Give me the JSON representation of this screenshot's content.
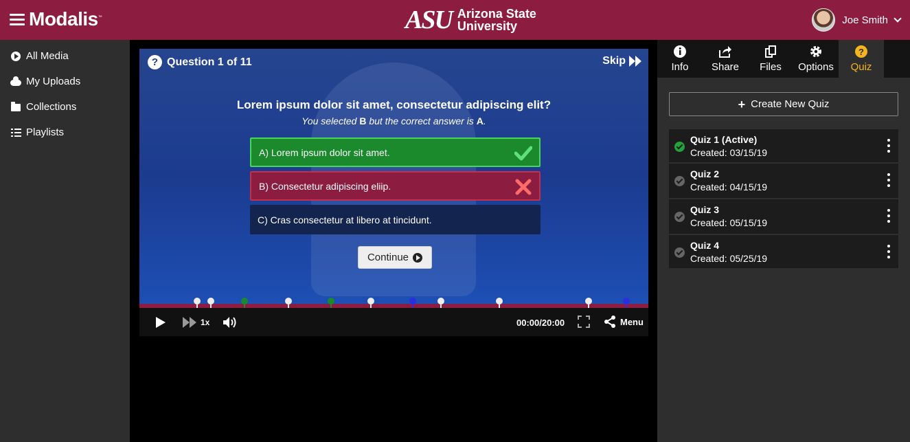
{
  "header": {
    "brand": "Modalis",
    "brand_tm": "™",
    "university_mark": "ASU",
    "university_line1": "Arizona State",
    "university_line2": "University",
    "user_name": "Joe Smith",
    "accent_color": "#8c1d40"
  },
  "sidebar": {
    "items": [
      {
        "label": "All Media",
        "icon": "play-circle-icon"
      },
      {
        "label": "My Uploads",
        "icon": "cloud-icon"
      },
      {
        "label": "Collections",
        "icon": "folder-icon"
      },
      {
        "label": "Playlists",
        "icon": "list-icon"
      }
    ]
  },
  "quiz_overlay": {
    "progress": "Question 1 of 11",
    "skip_label": "Skip",
    "question": "Lorem ipsum dolor sit amet, consectetur adipiscing elit?",
    "feedback_prefix": "You selected",
    "selected": "B",
    "feedback_middle": "but the correct answer is",
    "correct": "A",
    "feedback_end": ".",
    "answers": [
      {
        "text": "A) Lorem ipsum dolor sit amet.",
        "state": "correct"
      },
      {
        "text": "B) Consectetur adipiscing eliip.",
        "state": "wrong"
      },
      {
        "text": "C) Cras consectetur at libero at tincidunt.",
        "state": "neutral"
      }
    ],
    "continue_label": "Continue"
  },
  "player": {
    "speed": "1x",
    "time": "00:00/20:00",
    "menu_label": "Menu",
    "markers": [
      {
        "pos": 0.113,
        "color": "#eeeeee"
      },
      {
        "pos": 0.14,
        "color": "#eeeeee"
      },
      {
        "pos": 0.207,
        "color": "#1a8a2c"
      },
      {
        "pos": 0.293,
        "color": "#eeeeee"
      },
      {
        "pos": 0.377,
        "color": "#1a8a2c"
      },
      {
        "pos": 0.455,
        "color": "#eeeeee"
      },
      {
        "pos": 0.537,
        "color": "#2a2ee0"
      },
      {
        "pos": 0.593,
        "color": "#eeeeee"
      },
      {
        "pos": 0.707,
        "color": "#eeeeee"
      },
      {
        "pos": 0.883,
        "color": "#eeeeee"
      },
      {
        "pos": 0.957,
        "color": "#2a2ee0"
      }
    ]
  },
  "right_panel": {
    "tabs": [
      {
        "label": "Info",
        "icon": "info-icon"
      },
      {
        "label": "Share",
        "icon": "share-icon"
      },
      {
        "label": "Files",
        "icon": "files-icon"
      },
      {
        "label": "Options",
        "icon": "gear-icon"
      },
      {
        "label": "Quiz",
        "icon": "question-icon",
        "active": true
      }
    ],
    "create_label": "Create New Quiz",
    "quizzes": [
      {
        "title": "Quiz 1 (Active)",
        "created": "Created: 03/15/19",
        "active": true
      },
      {
        "title": "Quiz 2",
        "created": "Created: 04/15/19",
        "active": false
      },
      {
        "title": "Quiz 3",
        "created": "Created: 05/15/19",
        "active": false
      },
      {
        "title": "Quiz 4",
        "created": "Created: 05/25/19",
        "active": false
      }
    ]
  }
}
